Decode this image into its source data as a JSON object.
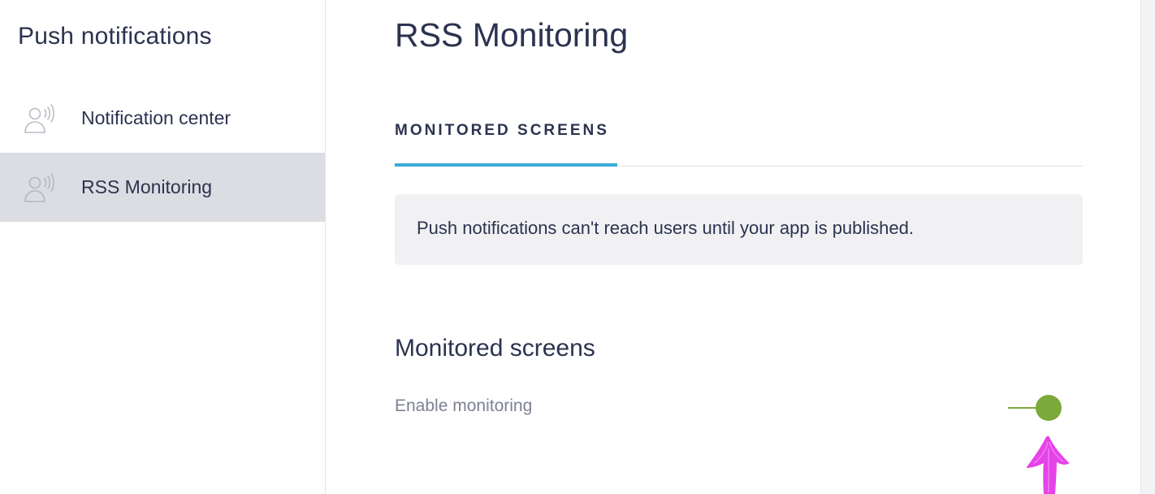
{
  "sidebar": {
    "title": "Push notifications",
    "items": [
      {
        "label": "Notification center",
        "icon": "broadcast-user-icon",
        "selected": false
      },
      {
        "label": "RSS Monitoring",
        "icon": "broadcast-user-icon",
        "selected": true
      }
    ]
  },
  "main": {
    "title": "RSS Monitoring",
    "tabs": [
      {
        "label": "MONITORED SCREENS",
        "active": true
      }
    ],
    "notice": "Push notifications can't reach users until your app is published.",
    "section_title": "Monitored screens",
    "setting": {
      "label": "Enable monitoring",
      "enabled": true
    }
  },
  "colors": {
    "text": "#2b3350",
    "muted_text": "#7c8193",
    "selected_nav_bg": "#dcdde2",
    "tab_underline": "#3aaad8",
    "notice_bg": "#f1f1f3",
    "toggle_on": "#7ba93a",
    "annotation": "#e543e8"
  }
}
